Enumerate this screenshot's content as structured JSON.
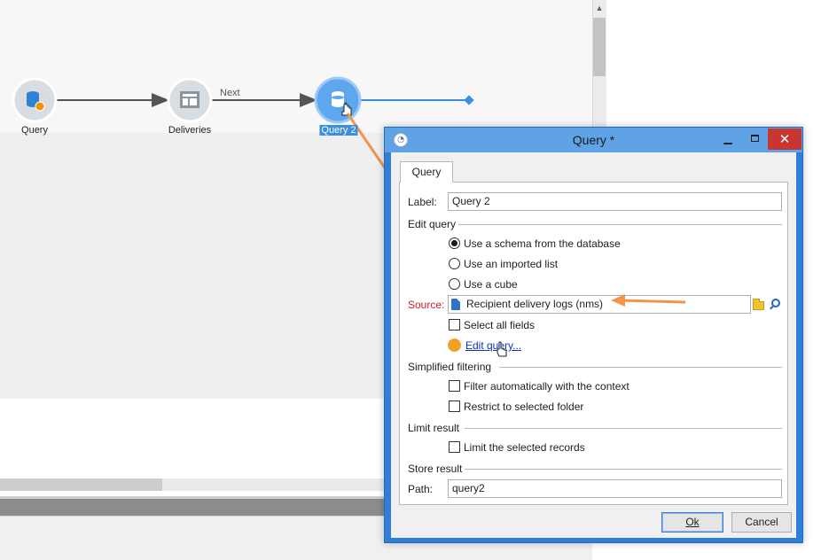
{
  "workflow": {
    "nodes": [
      {
        "label": "Query",
        "icon": "database-icon"
      },
      {
        "label": "Deliveries",
        "icon": "deliveries-icon"
      },
      {
        "label": "Query 2",
        "icon": "database-icon",
        "selected": true
      }
    ],
    "transition_label": "Next"
  },
  "dialog": {
    "title": "Query *",
    "tab": "Query",
    "label_caption": "Label:",
    "label_value": "Query 2",
    "edit_query_section": "Edit query",
    "radio_options": [
      {
        "label": "Use a schema from the database",
        "checked": true
      },
      {
        "label": "Use an imported list",
        "checked": false
      },
      {
        "label": "Use a cube",
        "checked": false
      }
    ],
    "source_caption": "Source:",
    "source_value": "Recipient delivery logs (nms)",
    "select_all_fields": "Select all fields",
    "edit_query_link": "Edit query...",
    "simplified_filtering_section": "Simplified filtering",
    "filter_context": "Filter automatically with the context",
    "restrict_folder": "Restrict to selected folder",
    "limit_result_section": "Limit result",
    "limit_records": "Limit the selected records",
    "store_result_section": "Store result",
    "path_caption": "Path:",
    "path_value": "query2",
    "ok_button": "Ok",
    "cancel_button": "Cancel"
  },
  "colors": {
    "accent": "#2f7fd6",
    "node_selected": "#5ea6ee",
    "arrow_annotation": "#f0954a",
    "close_button": "#c7372f",
    "required_label": "#c8202a",
    "link": "#0b34c6"
  }
}
